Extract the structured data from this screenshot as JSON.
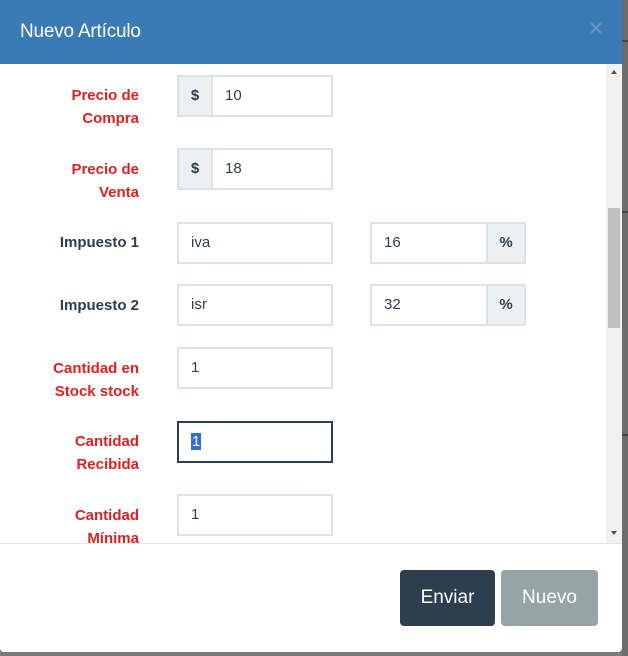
{
  "modal": {
    "title": "Nuevo Artículo",
    "close_glyph": "×"
  },
  "form": {
    "precio_compra": {
      "label_line1": "Precio de",
      "label_line2": "Compra",
      "prefix": "$",
      "value": "10",
      "required": true
    },
    "precio_venta": {
      "label_line1": "Precio de",
      "label_line2": "Venta",
      "prefix": "$",
      "value": "18",
      "required": true
    },
    "impuesto1": {
      "label": "Impuesto 1",
      "name_value": "iva",
      "rate_value": "16",
      "suffix": "%"
    },
    "impuesto2": {
      "label": "Impuesto 2",
      "name_value": "isr",
      "rate_value": "32",
      "suffix": "%"
    },
    "cantidad_stock": {
      "label_line1": "Cantidad en",
      "label_line2": "Stock stock",
      "value": "1",
      "required": true
    },
    "cantidad_recibida": {
      "label_line1": "Cantidad",
      "label_line2": "Recibida",
      "value": "1",
      "required": true,
      "focused": true
    },
    "cantidad_minima": {
      "label_line1": "Cantidad",
      "label_line2": "Mínima",
      "value": "1",
      "required": true
    }
  },
  "footer": {
    "submit_label": "Enviar",
    "new_label": "Nuevo"
  },
  "colors": {
    "header_bg": "#3a7ab5",
    "required_label": "#e02020",
    "normal_label": "#2d3e50",
    "primary_button": "#2d3e50",
    "secondary_button": "#95a5a6"
  },
  "icons": {
    "close": "close-icon",
    "scroll_up": "chevron-up-icon",
    "scroll_down": "chevron-down-icon"
  }
}
